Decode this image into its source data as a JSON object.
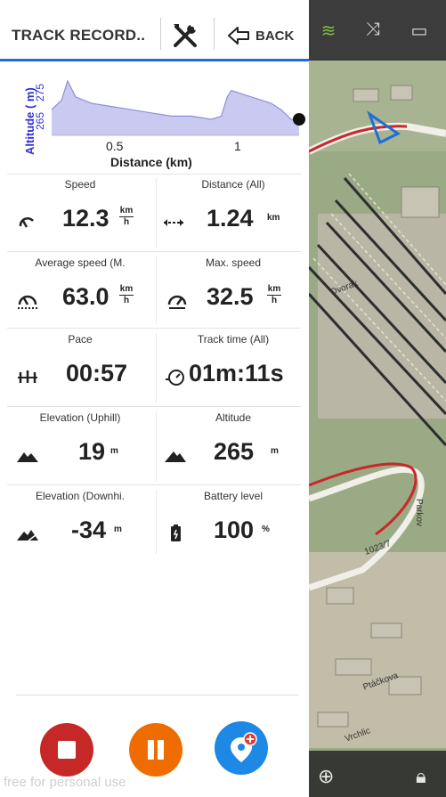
{
  "header": {
    "title": "TRACK RECORD..",
    "back_label": "BACK"
  },
  "chart_data": {
    "type": "area",
    "ylabel": "Altitude ( m)",
    "xlabel": "Distance (km)",
    "y_ticks": [
      "265",
      "275"
    ],
    "x_ticks": [
      "0.5",
      "1"
    ],
    "xlim": [
      0,
      1.24
    ],
    "ylim": [
      260,
      280
    ],
    "x": [
      0.0,
      0.05,
      0.08,
      0.12,
      0.2,
      0.3,
      0.4,
      0.5,
      0.6,
      0.7,
      0.8,
      0.85,
      0.88,
      0.9,
      0.95,
      1.0,
      1.05,
      1.1,
      1.15,
      1.2,
      1.24
    ],
    "y": [
      268,
      271,
      277,
      272,
      270,
      269,
      268,
      267,
      266,
      266,
      265,
      266,
      272,
      274,
      273,
      272,
      271,
      270,
      268,
      265,
      265
    ]
  },
  "metrics": [
    {
      "label": "Speed",
      "value": "12.3",
      "unit_top": "km",
      "unit_bottom": "h",
      "icon": "speedometer-icon"
    },
    {
      "label": "Distance (All)",
      "value": "1.24",
      "unit": "km",
      "icon": "distance-arrows-icon"
    },
    {
      "label": "Average speed (M.",
      "value": "63.0",
      "unit_top": "km",
      "unit_bottom": "h",
      "icon": "average-speed-icon"
    },
    {
      "label": "Max. speed",
      "value": "32.5",
      "unit_top": "km",
      "unit_bottom": "h",
      "icon": "max-speed-icon"
    },
    {
      "label": "Pace",
      "value": "00:57",
      "icon": "pace-icon"
    },
    {
      "label": "Track time (All)",
      "value": "01m:11s",
      "icon": "stopwatch-icon"
    },
    {
      "label": "Elevation (Uphill)",
      "value": "19",
      "unit": "m",
      "icon": "mountain-uphill-icon"
    },
    {
      "label": "Altitude",
      "value": "265",
      "unit": "m",
      "icon": "mountain-icon"
    },
    {
      "label": "Elevation (Downhi.",
      "value": "-34",
      "unit": "m",
      "icon": "mountain-downhill-icon"
    },
    {
      "label": "Battery level",
      "value": "100",
      "unit": "%",
      "icon": "battery-icon"
    }
  ],
  "buttons": {
    "stop_color": "#c62828",
    "pause_color": "#ef6c00",
    "waypoint_color": "#1e88e5"
  },
  "watermark": "free for personal use",
  "map": {
    "labels": [
      "Dvorak",
      "1023/7",
      "Parkov",
      "Ptáčkova",
      "Vrchlic"
    ]
  }
}
